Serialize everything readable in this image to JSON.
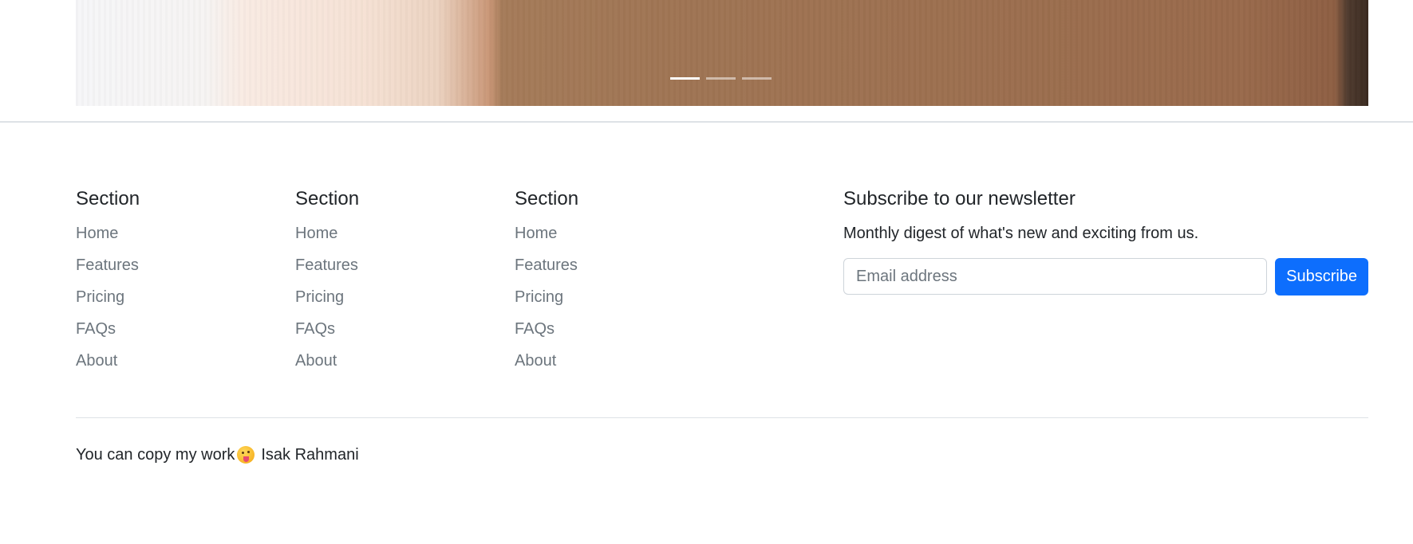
{
  "carousel": {
    "indicators": [
      {
        "label": "Slide 1",
        "active": true
      },
      {
        "label": "Slide 2",
        "active": false
      },
      {
        "label": "Slide 3",
        "active": false
      }
    ]
  },
  "footer": {
    "columns": [
      {
        "title": "Section",
        "links": [
          "Home",
          "Features",
          "Pricing",
          "FAQs",
          "About"
        ]
      },
      {
        "title": "Section",
        "links": [
          "Home",
          "Features",
          "Pricing",
          "FAQs",
          "About"
        ]
      },
      {
        "title": "Section",
        "links": [
          "Home",
          "Features",
          "Pricing",
          "FAQs",
          "About"
        ]
      }
    ],
    "newsletter": {
      "title": "Subscribe to our newsletter",
      "description": "Monthly digest of what's new and exciting from us.",
      "email_placeholder": "Email address",
      "button_label": "Subscribe"
    },
    "copyright": {
      "text": "You can copy my work",
      "emoji": "winking-face-with-tongue",
      "author": "Isak Rahmani"
    }
  },
  "colors": {
    "primary": "#0d6efd",
    "muted_text": "#6c757d",
    "body_text": "#212529",
    "divider": "#dee2e6"
  }
}
